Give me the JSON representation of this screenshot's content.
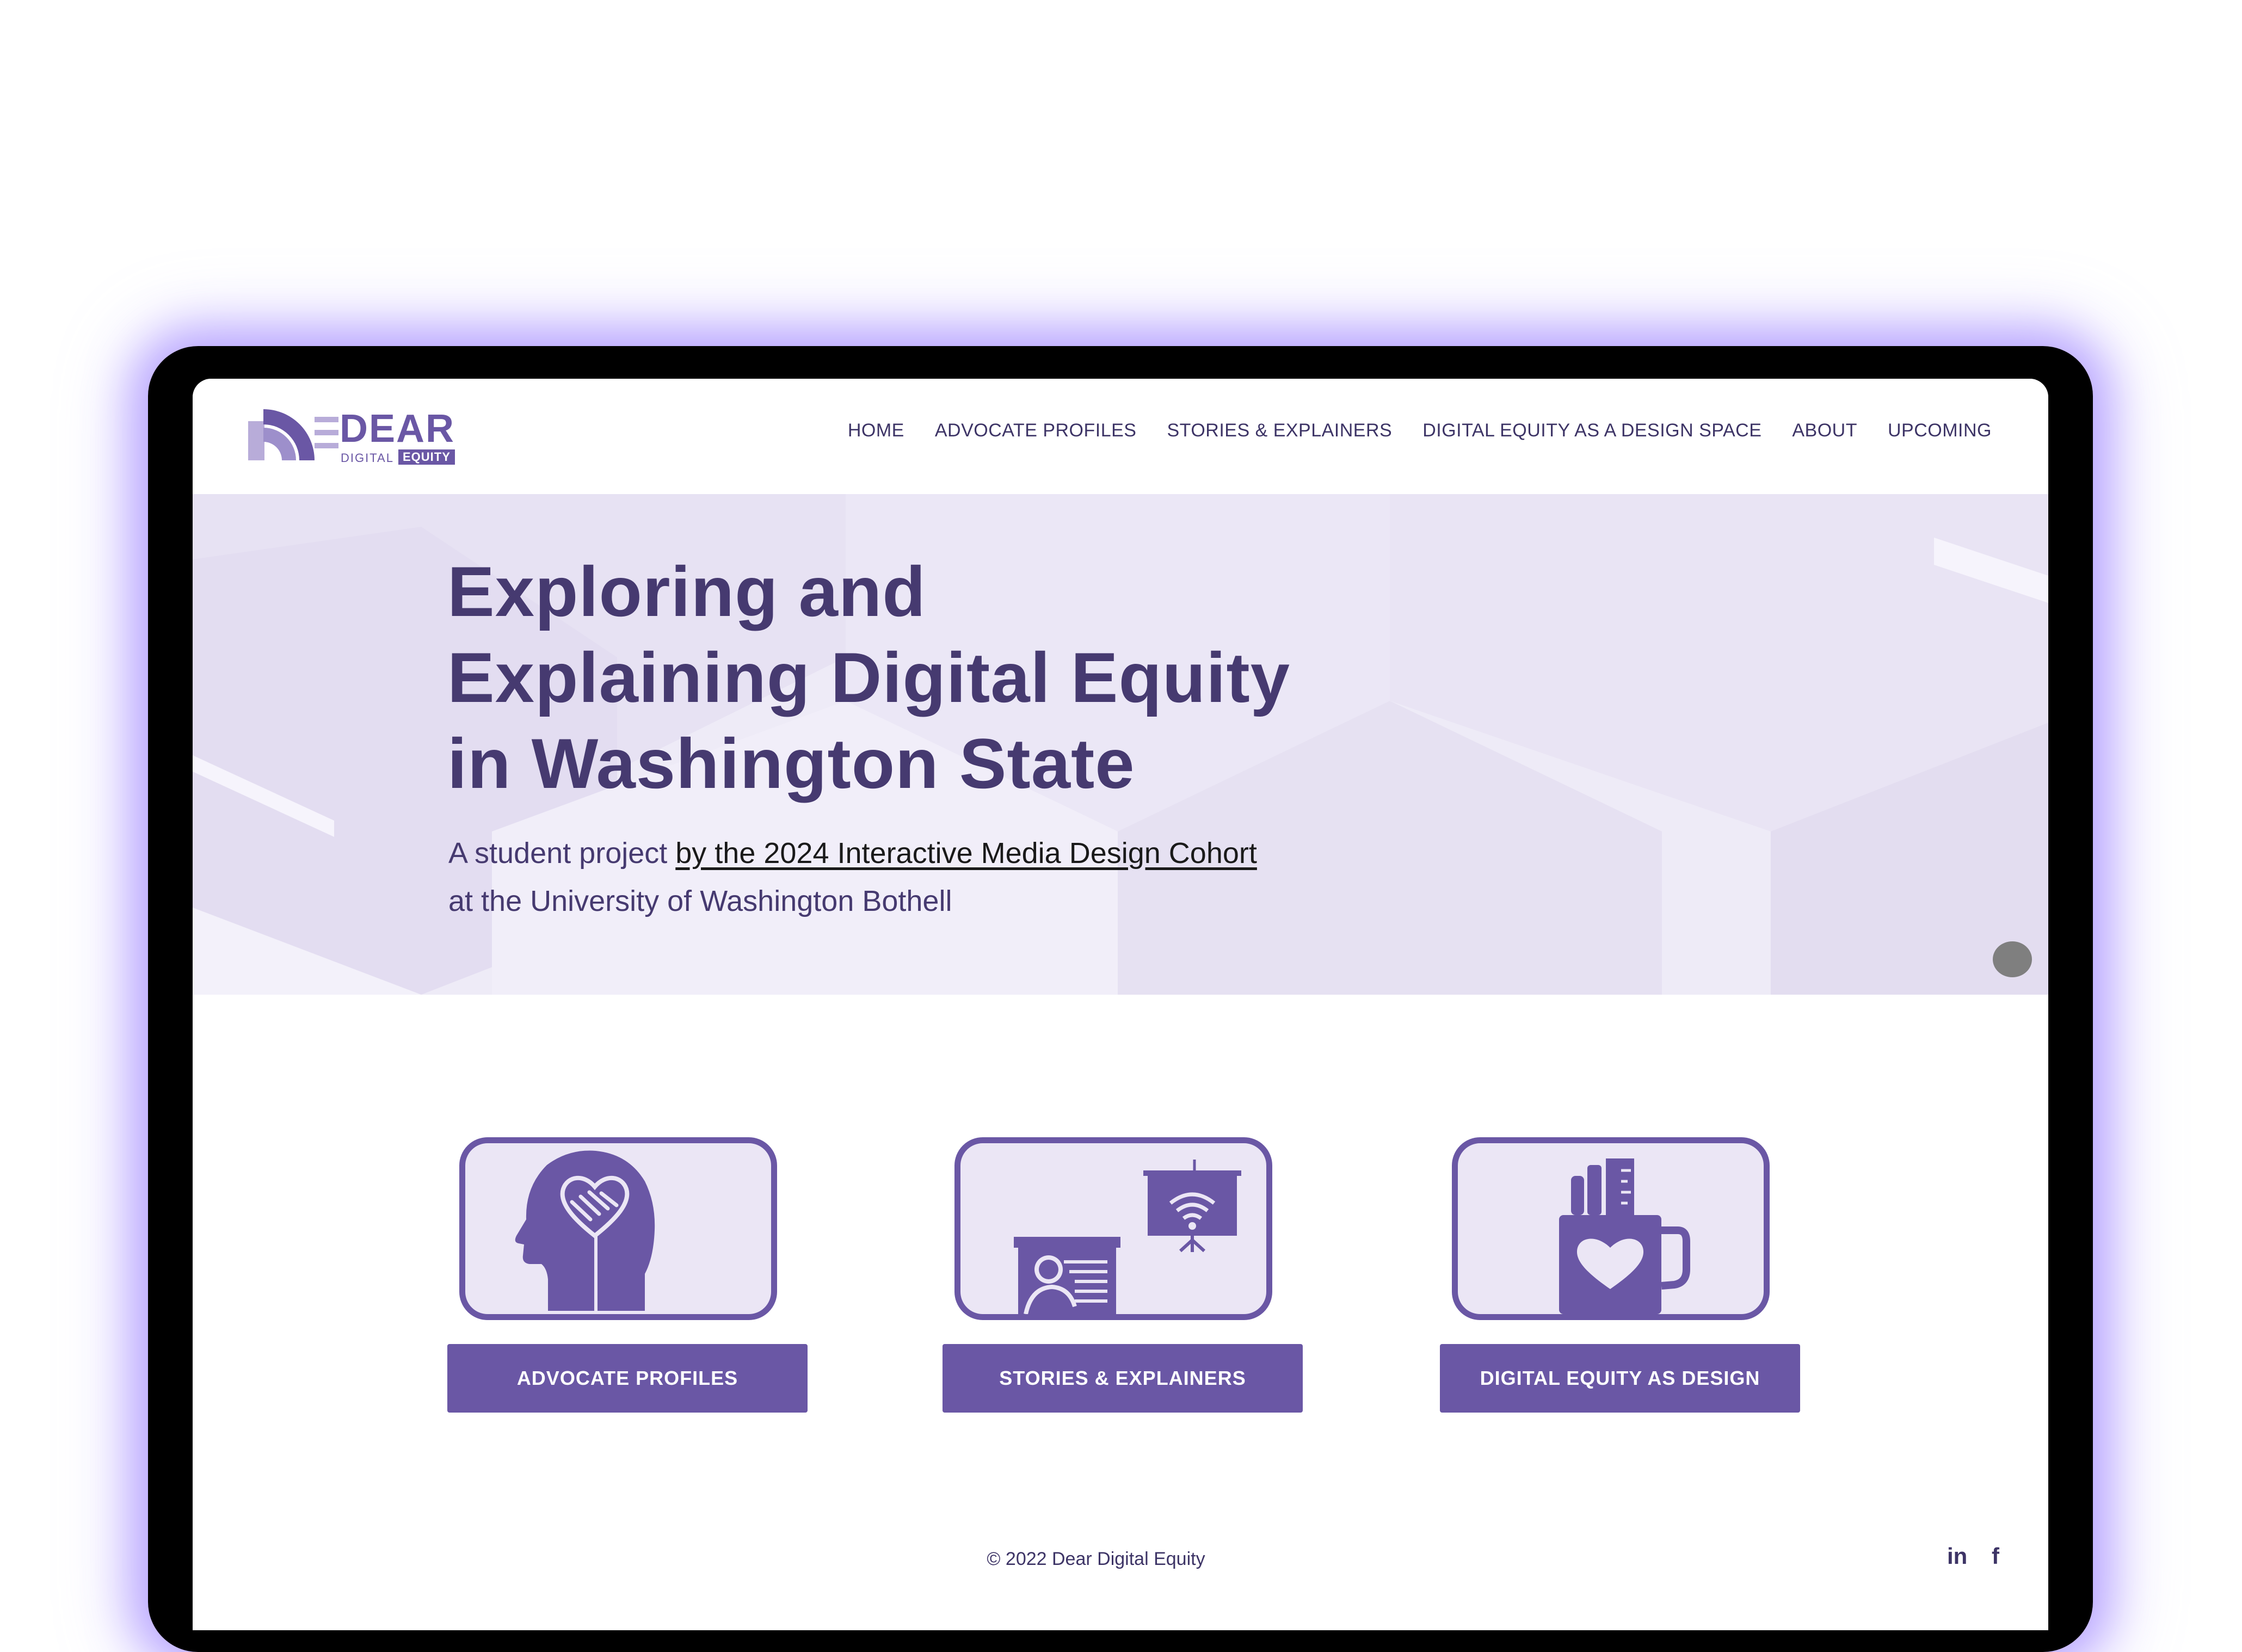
{
  "brand": {
    "logo_word": "DEAR",
    "logo_sub_left": "DIGITAL",
    "logo_sub_right": "EQUITY"
  },
  "nav": {
    "items": [
      {
        "label": "HOME"
      },
      {
        "label": "ADVOCATE PROFILES"
      },
      {
        "label": "STORIES & EXPLAINERS"
      },
      {
        "label": "DIGITAL EQUITY AS A DESIGN SPACE"
      },
      {
        "label": "ABOUT"
      },
      {
        "label": "UPCOMING"
      }
    ]
  },
  "hero": {
    "title_lines": [
      "Exploring and",
      "Explaining Digital Equity",
      "in Washington State"
    ],
    "subtitle_prefix": "A student project ",
    "subtitle_link": "by the 2024 Interactive Media Design Cohort",
    "subtitle_suffix": "at the University of Washington Bothell"
  },
  "cards": [
    {
      "icon": "head-heart-handshake-icon",
      "button": "ADVOCATE PROFILES"
    },
    {
      "icon": "presentation-wifi-icon",
      "button": "STORIES & EXPLAINERS"
    },
    {
      "icon": "mug-heart-pens-icon",
      "button": "DIGITAL EQUITY AS DESIGN"
    }
  ],
  "footer": {
    "copyright": "© 2022 Dear Digital Equity",
    "social": [
      {
        "icon": "linkedin-icon",
        "label": "in"
      },
      {
        "icon": "facebook-icon",
        "label": "f"
      }
    ]
  },
  "colors": {
    "accent": "#6a57a5",
    "heading": "#463a70",
    "hero_bg": "#eeebf7",
    "card_fill": "#ebe6f5",
    "laptop_frame": "#000000",
    "glow": "#9b87ff"
  }
}
